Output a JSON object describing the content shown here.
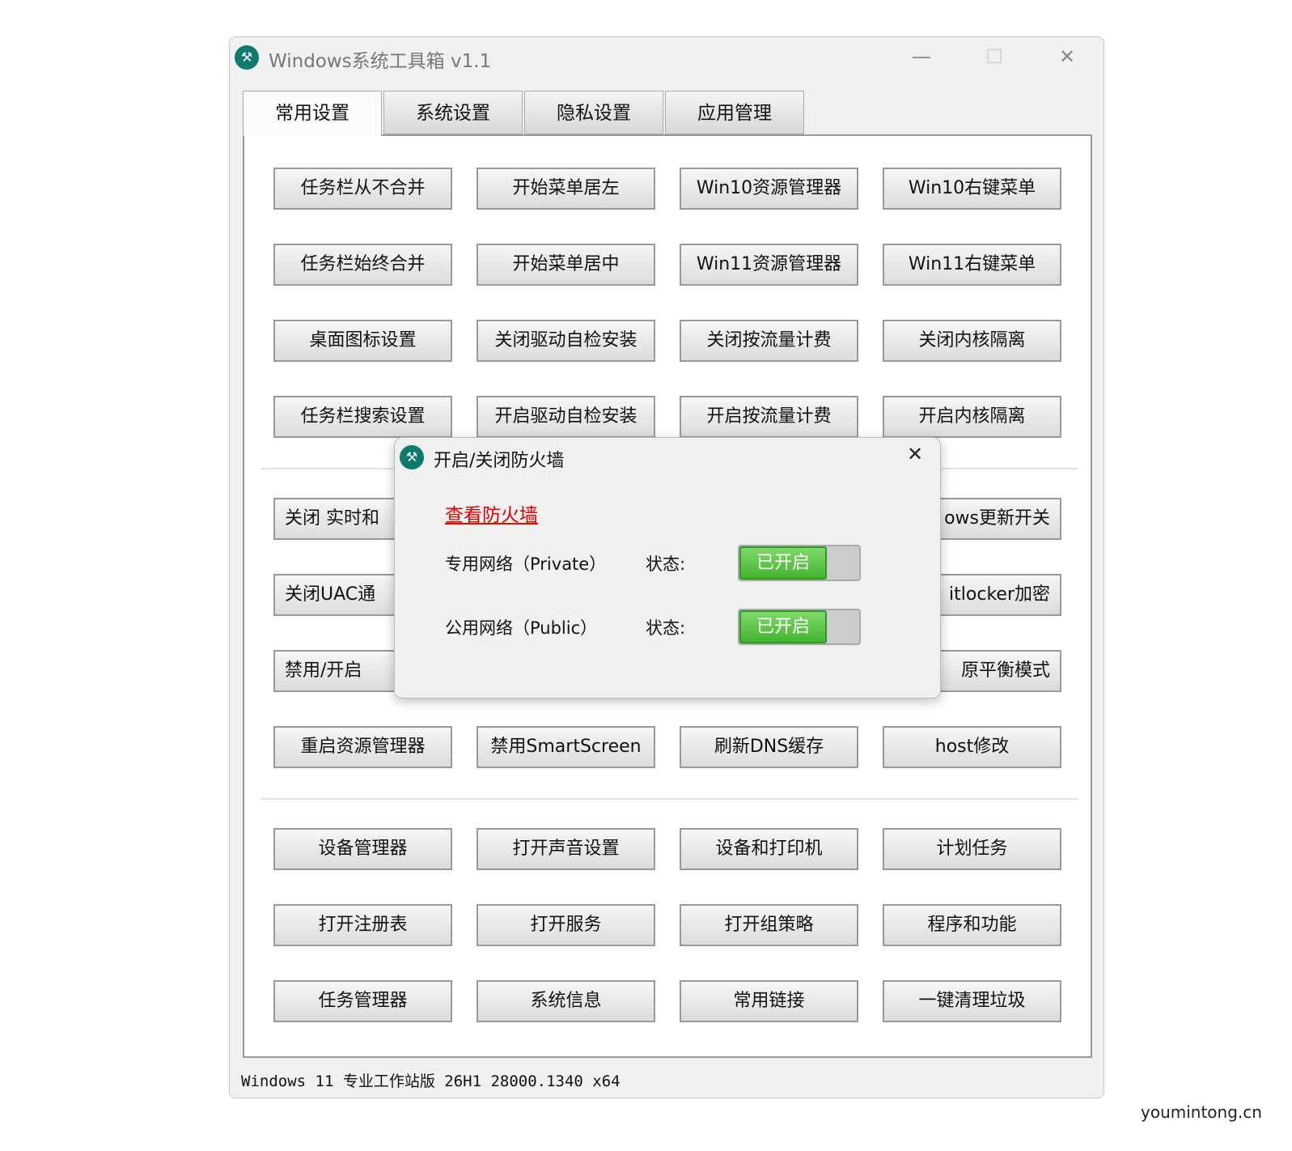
{
  "window": {
    "title": "Windows系统工具箱 v1.1",
    "minimize": "—",
    "maximize": "☐",
    "close": "✕"
  },
  "tabs": [
    "常用设置",
    "系统设置",
    "隐私设置",
    "应用管理"
  ],
  "buttons": {
    "row1": [
      "任务栏从不合并",
      "开始菜单居左",
      "Win10资源管理器",
      "Win10右键菜单"
    ],
    "row2": [
      "任务栏始终合并",
      "开始菜单居中",
      "Win11资源管理器",
      "Win11右键菜单"
    ],
    "row3": [
      "桌面图标设置",
      "关闭驱动自检安装",
      "关闭按流量计费",
      "关闭内核隔离"
    ],
    "row4": [
      "任务栏搜索设置",
      "开启驱动自检安装",
      "开启按流量计费",
      "开启内核隔离"
    ],
    "row5": [
      "关闭 实时和",
      "ows更新开关"
    ],
    "row6": [
      "关闭UAC通",
      "itlocker加密"
    ],
    "row7": [
      "禁用/开启",
      "原平衡模式"
    ],
    "row8": [
      "重启资源管理器",
      "禁用SmartScreen",
      "刷新DNS缓存",
      "host修改"
    ],
    "row9": [
      "设备管理器",
      "打开声音设置",
      "设备和打印机",
      "计划任务"
    ],
    "row10": [
      "打开注册表",
      "打开服务",
      "打开组策略",
      "程序和功能"
    ],
    "row11": [
      "任务管理器",
      "系统信息",
      "常用链接",
      "一键清理垃圾"
    ]
  },
  "status": "Windows 11 专业工作站版 26H1 28000.1340 x64",
  "dialog": {
    "title": "开启/关闭防火墙",
    "close": "✕",
    "link": "查看防火墙",
    "private": {
      "label": "专用网络（Private）",
      "state_label": "状态:",
      "toggle": "已开启",
      "on": true
    },
    "public": {
      "label": "公用网络（Public）",
      "state_label": "状态:",
      "toggle": "已开启",
      "on": true
    }
  },
  "watermark": "youmintong.cn",
  "colors": {
    "accent": "#0f7b6c",
    "toggle_on": "#44b52f",
    "link": "#e00000"
  }
}
